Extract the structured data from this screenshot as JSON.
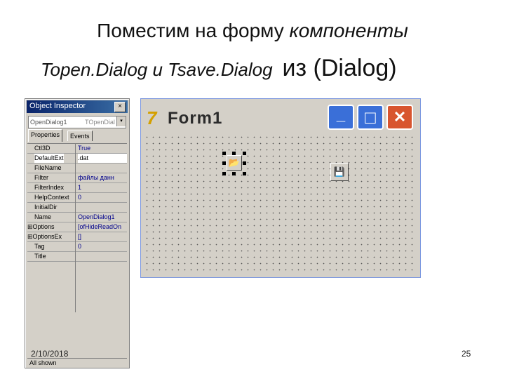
{
  "slide": {
    "title_line1_plain": "Поместим на форму ",
    "title_line1_italic": "компоненты",
    "title_line2_italic": "Topen.Dialog и Tsave.Dialog",
    "title_line2_plain": "из (Dialog)",
    "date": "2/10/2018",
    "page_number": "25"
  },
  "object_inspector": {
    "title": "Object Inspector",
    "close_glyph": "×",
    "combo_left": "OpenDialog1",
    "combo_right": "TOpenDial",
    "combo_arrow": "▾",
    "tabs": [
      "Properties",
      "Events"
    ],
    "rows": [
      {
        "key": "Ctl3D",
        "value": "True"
      },
      {
        "key": "DefaultExt",
        "value": ".dat"
      },
      {
        "key": "FileName",
        "value": ""
      },
      {
        "key": "Filter",
        "value": "файлы данн"
      },
      {
        "key": "FilterIndex",
        "value": "1"
      },
      {
        "key": "HelpContext",
        "value": "0"
      },
      {
        "key": "InitialDir",
        "value": ""
      },
      {
        "key": "Name",
        "value": "OpenDialog1"
      },
      {
        "key": "⊞Options",
        "value": "[ofHideReadOn"
      },
      {
        "key": "⊞OptionsEx",
        "value": "[]"
      },
      {
        "key": "Tag",
        "value": "0"
      },
      {
        "key": "Title",
        "value": ""
      }
    ],
    "status": "All shown"
  },
  "form": {
    "caption": "Form1",
    "app_icon_glyph": "7",
    "min_glyph": "_",
    "max_glyph": "□",
    "close_glyph": "✕",
    "open_dialog_icon": "📂",
    "save_dialog_icon": "💾"
  }
}
